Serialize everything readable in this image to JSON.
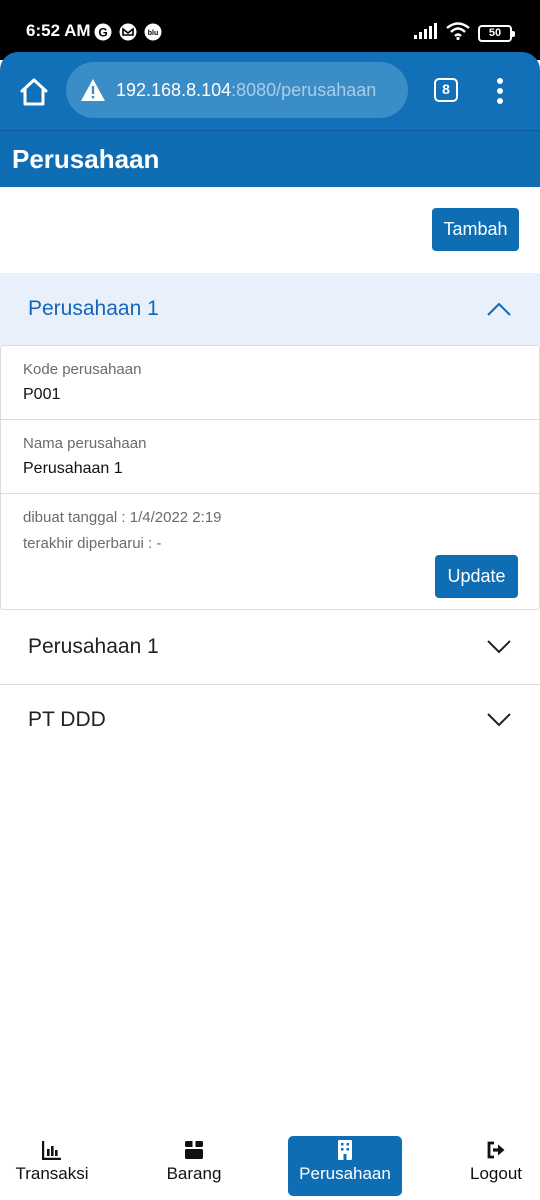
{
  "status_bar": {
    "time": "6:52 AM",
    "battery": "50",
    "icons": [
      "google-icon",
      "gmail-icon",
      "blu-icon",
      "signal-icon",
      "wifi-icon",
      "battery-icon"
    ]
  },
  "browser": {
    "url_host": "192.168.8.104",
    "url_path": ":8080/perusahaan",
    "tab_count": "8",
    "icons": [
      "home-icon",
      "warning-icon",
      "overflow-menu-icon"
    ]
  },
  "app": {
    "title": "Perusahaan",
    "add_button_label": "Tambah",
    "accent_color": "#0f6db4"
  },
  "companies": [
    {
      "name": "Perusahaan 1",
      "expanded": true,
      "code_label": "Kode perusahaan",
      "code_value": "P001",
      "name_label": "Nama perusahaan",
      "name_value": "Perusahaan 1",
      "created": "dibuat tanggal : 1/4/2022 2:19",
      "updated": "terakhir diperbarui : -",
      "update_button_label": "Update"
    },
    {
      "name": "Perusahaan 1",
      "expanded": false
    },
    {
      "name": "PT DDD",
      "expanded": false
    }
  ],
  "bottom_nav": {
    "items": [
      {
        "label": "Transaksi",
        "icon": "bar-chart-icon",
        "active": false
      },
      {
        "label": "Barang",
        "icon": "box-icon",
        "active": false
      },
      {
        "label": "Perusahaan",
        "icon": "building-icon",
        "active": true
      },
      {
        "label": "Logout",
        "icon": "logout-icon",
        "active": false
      }
    ]
  }
}
